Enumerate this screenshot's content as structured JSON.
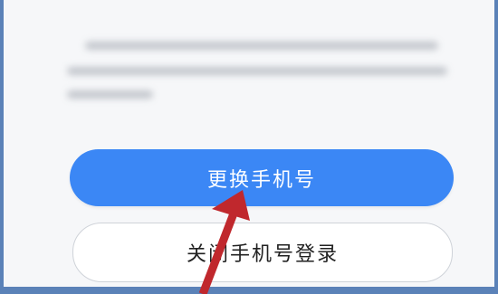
{
  "buttons": {
    "change_phone_label": "更换手机号",
    "close_phone_login_label": "关闭手机号登录"
  },
  "colors": {
    "primary_button": "#3b87f5",
    "annotation_arrow": "#c0282d",
    "frame": "#5b82b8"
  }
}
